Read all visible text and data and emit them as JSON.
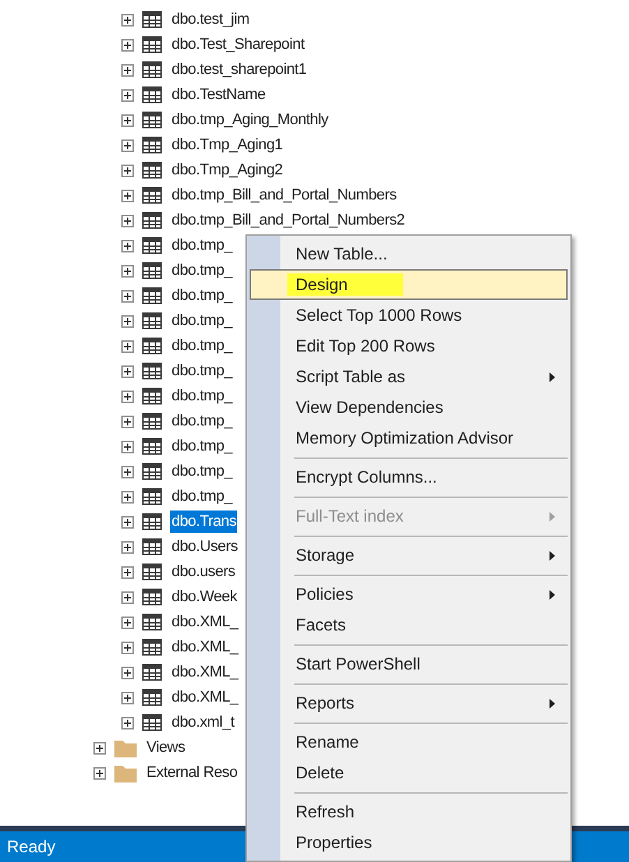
{
  "tree": {
    "tables": [
      {
        "label": "dbo.test_jim",
        "selected": false
      },
      {
        "label": "dbo.Test_Sharepoint",
        "selected": false
      },
      {
        "label": "dbo.test_sharepoint1",
        "selected": false
      },
      {
        "label": "dbo.TestName",
        "selected": false
      },
      {
        "label": "dbo.tmp_Aging_Monthly",
        "selected": false
      },
      {
        "label": "dbo.Tmp_Aging1",
        "selected": false
      },
      {
        "label": "dbo.Tmp_Aging2",
        "selected": false
      },
      {
        "label": "dbo.tmp_Bill_and_Portal_Numbers",
        "selected": false
      },
      {
        "label": "dbo.tmp_Bill_and_Portal_Numbers2",
        "selected": false
      },
      {
        "label": "dbo.tmp_",
        "selected": false
      },
      {
        "label": "dbo.tmp_",
        "selected": false
      },
      {
        "label": "dbo.tmp_",
        "selected": false
      },
      {
        "label": "dbo.tmp_",
        "selected": false
      },
      {
        "label": "dbo.tmp_",
        "selected": false
      },
      {
        "label": "dbo.tmp_",
        "selected": false
      },
      {
        "label": "dbo.tmp_",
        "selected": false
      },
      {
        "label": "dbo.tmp_",
        "selected": false
      },
      {
        "label": "dbo.tmp_",
        "selected": false
      },
      {
        "label": "dbo.tmp_",
        "selected": false
      },
      {
        "label": "dbo.tmp_",
        "selected": false
      },
      {
        "label": "dbo.Trans",
        "selected": true
      },
      {
        "label": "dbo.Users",
        "selected": false
      },
      {
        "label": "dbo.users",
        "selected": false
      },
      {
        "label": "dbo.Week",
        "selected": false
      },
      {
        "label": "dbo.XML_",
        "selected": false
      },
      {
        "label": "dbo.XML_",
        "selected": false
      },
      {
        "label": "dbo.XML_",
        "selected": false
      },
      {
        "label": "dbo.XML_",
        "selected": false
      },
      {
        "label": "dbo.xml_t",
        "selected": false
      }
    ],
    "folders": [
      {
        "label": "Views"
      },
      {
        "label": "External Reso"
      }
    ]
  },
  "context_menu": [
    {
      "kind": "item",
      "label": "New Table...",
      "selected": false,
      "submenu": false,
      "disabled": false
    },
    {
      "kind": "item",
      "label": "Design",
      "selected": true,
      "submenu": false,
      "disabled": false
    },
    {
      "kind": "item",
      "label": "Select Top 1000 Rows",
      "selected": false,
      "submenu": false,
      "disabled": false
    },
    {
      "kind": "item",
      "label": "Edit Top 200 Rows",
      "selected": false,
      "submenu": false,
      "disabled": false
    },
    {
      "kind": "item",
      "label": "Script Table as",
      "selected": false,
      "submenu": true,
      "disabled": false
    },
    {
      "kind": "item",
      "label": "View Dependencies",
      "selected": false,
      "submenu": false,
      "disabled": false
    },
    {
      "kind": "item",
      "label": "Memory Optimization Advisor",
      "selected": false,
      "submenu": false,
      "disabled": false
    },
    {
      "kind": "separator"
    },
    {
      "kind": "item",
      "label": "Encrypt Columns...",
      "selected": false,
      "submenu": false,
      "disabled": false
    },
    {
      "kind": "separator"
    },
    {
      "kind": "item",
      "label": "Full-Text index",
      "selected": false,
      "submenu": true,
      "disabled": true
    },
    {
      "kind": "separator"
    },
    {
      "kind": "item",
      "label": "Storage",
      "selected": false,
      "submenu": true,
      "disabled": false
    },
    {
      "kind": "separator"
    },
    {
      "kind": "item",
      "label": "Policies",
      "selected": false,
      "submenu": true,
      "disabled": false
    },
    {
      "kind": "item",
      "label": "Facets",
      "selected": false,
      "submenu": false,
      "disabled": false
    },
    {
      "kind": "separator"
    },
    {
      "kind": "item",
      "label": "Start PowerShell",
      "selected": false,
      "submenu": false,
      "disabled": false
    },
    {
      "kind": "separator"
    },
    {
      "kind": "item",
      "label": "Reports",
      "selected": false,
      "submenu": true,
      "disabled": false
    },
    {
      "kind": "separator"
    },
    {
      "kind": "item",
      "label": "Rename",
      "selected": false,
      "submenu": false,
      "disabled": false
    },
    {
      "kind": "item",
      "label": "Delete",
      "selected": false,
      "submenu": false,
      "disabled": false
    },
    {
      "kind": "separator"
    },
    {
      "kind": "item",
      "label": "Refresh",
      "selected": false,
      "submenu": false,
      "disabled": false
    },
    {
      "kind": "item",
      "label": "Properties",
      "selected": false,
      "submenu": false,
      "disabled": false
    }
  ],
  "status_bar": {
    "text": "Ready"
  }
}
